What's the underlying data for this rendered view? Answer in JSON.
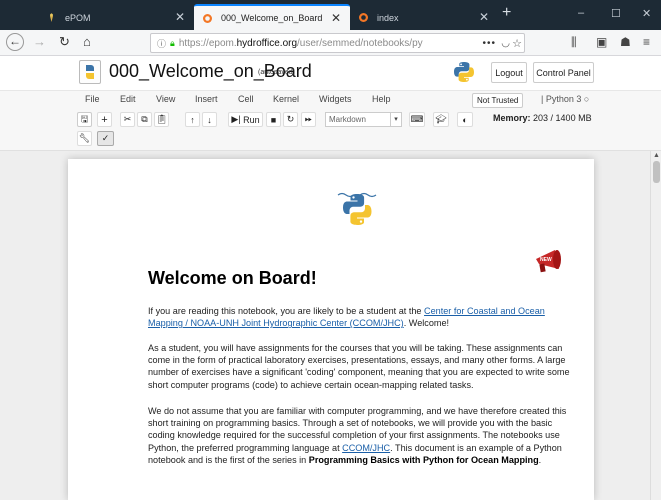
{
  "browser": {
    "tabs": [
      {
        "label": "ePOM",
        "active": false
      },
      {
        "label": "000_Welcome_on_Board",
        "active": true
      },
      {
        "label": "index",
        "active": false
      }
    ],
    "new_tab": "+",
    "window_controls": [
      "–",
      "☐",
      "✕"
    ],
    "url": {
      "scheme": "https://epom.",
      "host": "hydroffice.org",
      "rest": "/user/semmed/notebooks/py",
      "dots": "•••"
    }
  },
  "notebook": {
    "title": "000_Welcome_on_Board",
    "save_status": "(autosaved)",
    "logout_label": "Logout",
    "control_panel_label": "Control Panel"
  },
  "menu": {
    "items": [
      "File",
      "Edit",
      "View",
      "Insert",
      "Cell",
      "Kernel",
      "Widgets",
      "Help"
    ],
    "trust": "Not Trusted",
    "kernel": "Python 3"
  },
  "toolbar": {
    "run_label": "Run",
    "cell_type": "Markdown",
    "memory_label": "Memory:",
    "memory_value": "203 / 1400 MB"
  },
  "content": {
    "heading": "Welcome on Board!",
    "p1": {
      "before": "If you are reading this notebook, you are likely to be a student at the ",
      "link": "Center for Coastal and Ocean Mapping / NOAA-UNH Joint Hydrographic Center (CCOM/JHC)",
      "after": ". Welcome!"
    },
    "p2": "As a student, you will have assignments for the courses that you will be taking. These assignments can come in the form of practical laboratory exercises, presentations, essays, and many other forms. A large number of exercises have a significant 'coding' component, meaning that you are expected to write some short computer programs (code) to achieve certain ocean-mapping related tasks.",
    "p3": {
      "before": "We do not assume that you are familiar with computer programming, and we have therefore created this short training on programming basics. Through a set of notebooks, we will provide you with the basic coding knowledge required for the successful completion of your first assignments. The notebooks use Python, the preferred programming language at ",
      "link": "CCOM/JHC",
      "middle": ". This document is an example of a Python notebook and is the first of the series in ",
      "bold": "Programming Basics with Python for Ocean Mapping",
      "after": "."
    }
  },
  "colors": {
    "tab_bar": "#1d2a35",
    "link": "#1a5fa8",
    "active_tab_accent": "#0a84ff"
  }
}
